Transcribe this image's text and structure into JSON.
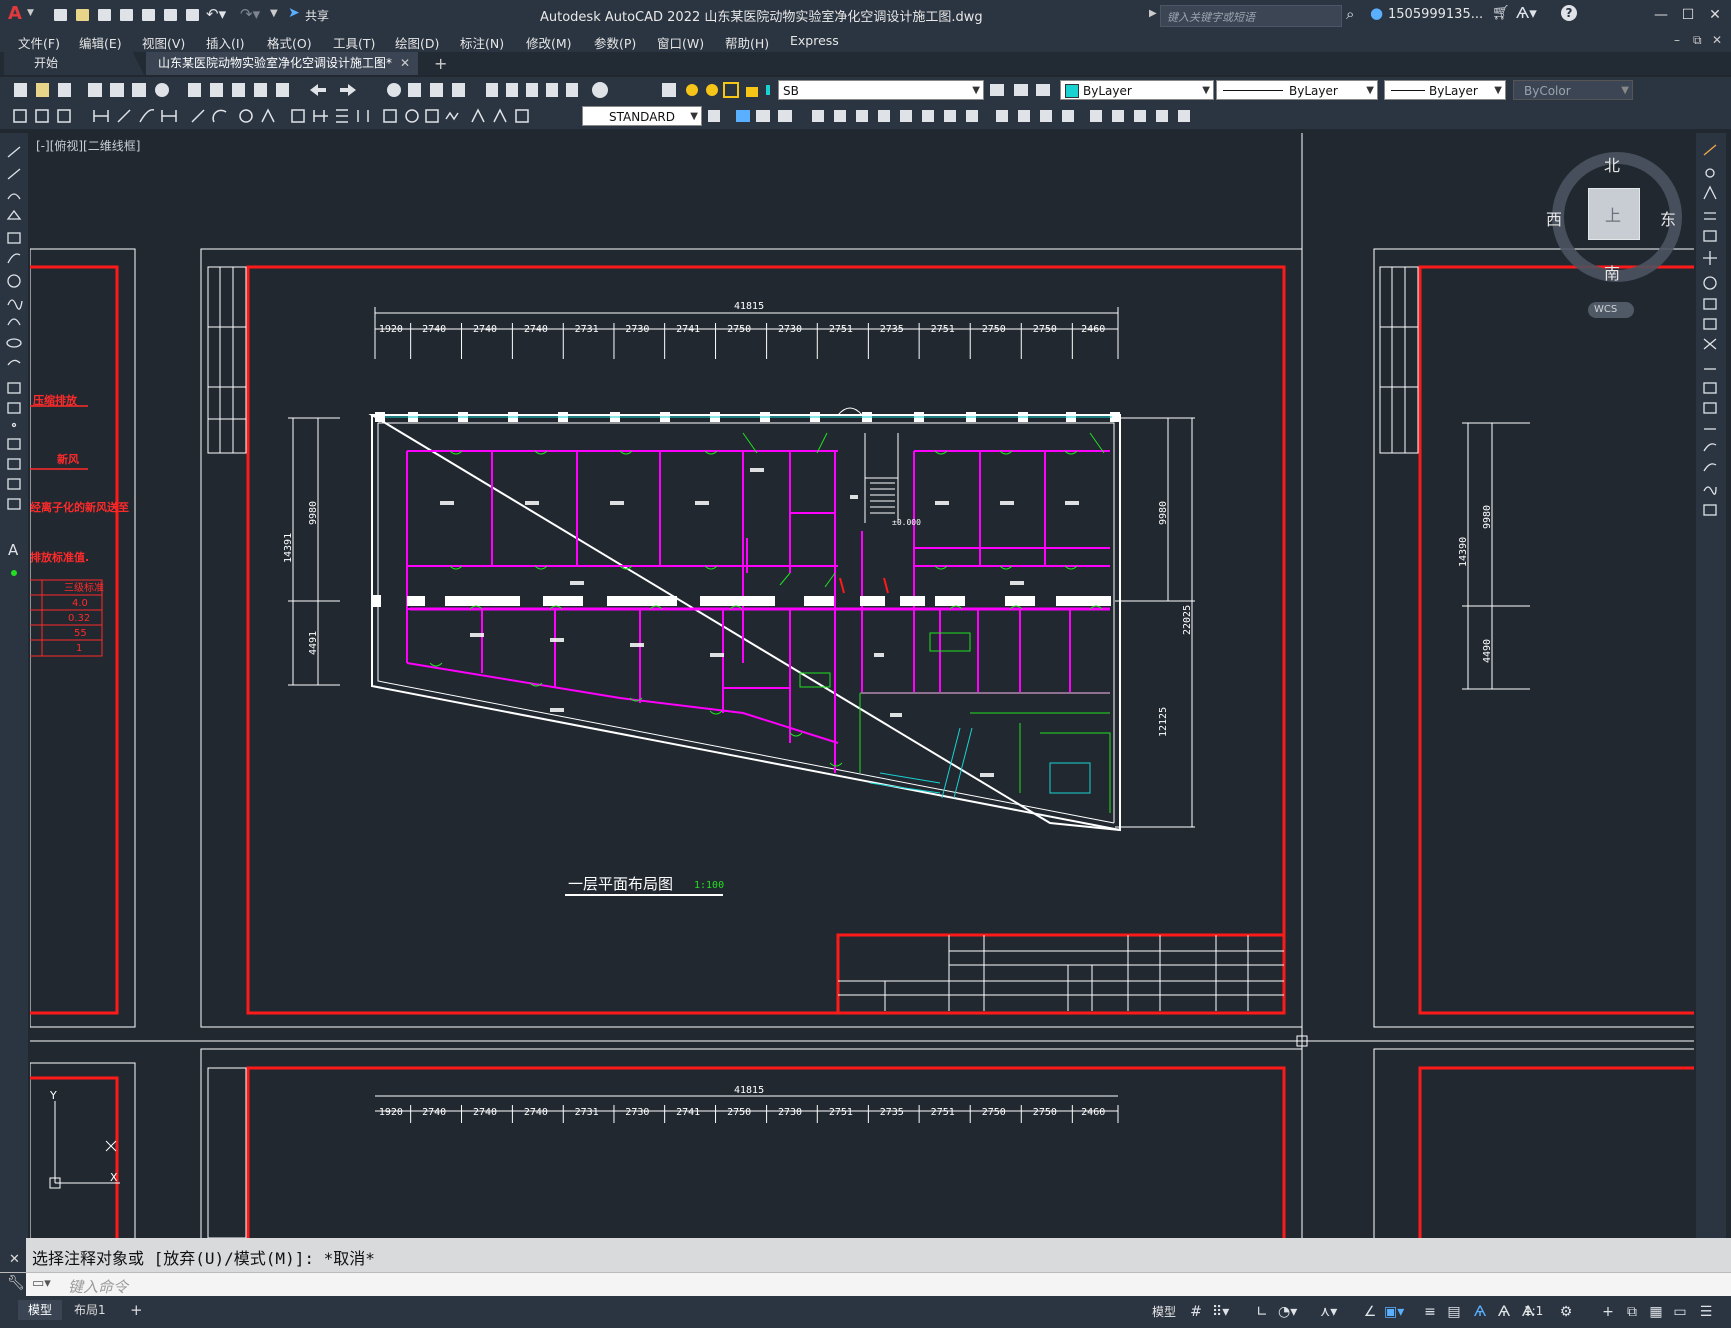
{
  "app": {
    "title": "Autodesk AutoCAD 2022    山东某医院动物实验室净化空调设计施工图.dwg",
    "logo": "A",
    "share_label": "共享",
    "search_placeholder": "键入关键字或短语",
    "user": "1505999135...",
    "help": "?"
  },
  "menus": [
    "文件(F)",
    "编辑(E)",
    "视图(V)",
    "插入(I)",
    "格式(O)",
    "工具(T)",
    "绘图(D)",
    "标注(N)",
    "修改(M)",
    "参数(P)",
    "窗口(W)",
    "帮助(H)",
    "Express"
  ],
  "tabs": {
    "start": "开始",
    "active": "山东某医院动物实验室净化空调设计施工图*",
    "add": "+"
  },
  "props": {
    "layer": "SB",
    "color": "ByLayer",
    "linetype": "ByLayer",
    "lineweight": "ByLayer",
    "plotstyle": "ByColor",
    "textstyle": "STANDARD"
  },
  "viewport_label": "[-][俯视][二维线框]",
  "viewcube": {
    "north": "北",
    "south": "南",
    "east": "东",
    "west": "西",
    "top": "上",
    "wcs": "WCS"
  },
  "drawing": {
    "title": "一层平面布局图",
    "scale": "1:100",
    "total_width": "41815",
    "top_dims": [
      "1920",
      "2740",
      "2740",
      "2740",
      "2731",
      "2730",
      "2741",
      "2750",
      "2730",
      "2751",
      "2735",
      "2751",
      "2750",
      "2750",
      "2460"
    ],
    "left_dims": [
      "14391",
      "9980",
      "4491"
    ],
    "right_dims": [
      "9980",
      "22025",
      "12125"
    ],
    "right_panel_dims": [
      "14390",
      "9980",
      "4490"
    ],
    "left_panel_texts": [
      "压缩排放",
      "新风",
      "经离子化的新风送至",
      "排放标准值.",
      "三级标准",
      "4.0",
      "0.32",
      "55",
      "1"
    ],
    "stair_level": "±0.000"
  },
  "command": {
    "history": "选择注释对象或 [放弃(U)/模式(M)]: *取消*",
    "placeholder": "键入命令"
  },
  "layouts": [
    "模型",
    "布局1",
    "+"
  ],
  "status": {
    "model": "模型",
    "scale": "1:1"
  }
}
